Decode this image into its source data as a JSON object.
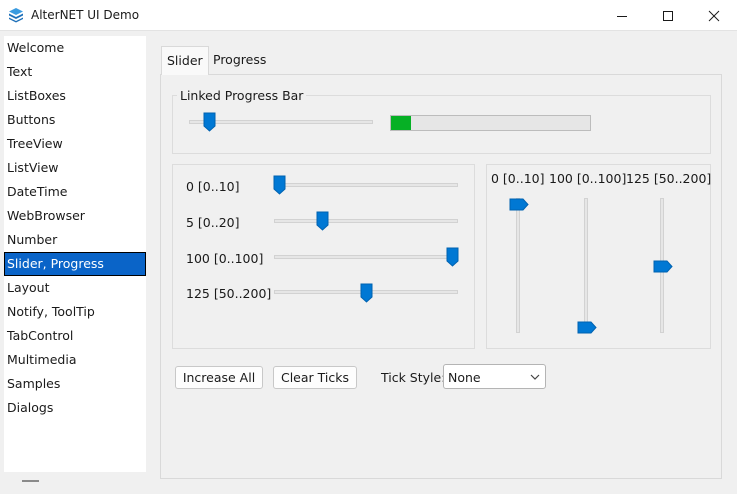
{
  "window": {
    "title": "AlterNET UI Demo"
  },
  "sidebar": {
    "items": [
      {
        "label": "Welcome"
      },
      {
        "label": "Text"
      },
      {
        "label": "ListBoxes"
      },
      {
        "label": "Buttons"
      },
      {
        "label": "TreeView"
      },
      {
        "label": "ListView"
      },
      {
        "label": "DateTime"
      },
      {
        "label": "WebBrowser"
      },
      {
        "label": "Number"
      },
      {
        "label": "Slider, Progress"
      },
      {
        "label": "Layout"
      },
      {
        "label": "Notify, ToolTip"
      },
      {
        "label": "TabControl"
      },
      {
        "label": "Multimedia"
      },
      {
        "label": "Samples"
      },
      {
        "label": "Dialogs"
      }
    ],
    "selected_index": 9
  },
  "tabs": [
    {
      "label": "Slider",
      "active": true
    },
    {
      "label": "Progress",
      "active": false
    }
  ],
  "linked_group": {
    "title": "Linked Progress Bar",
    "slider_value": 0.12,
    "progress_value": 0.1,
    "progress_color": "#06b025"
  },
  "horizontal_sliders": [
    {
      "label": "0 [0..10]",
      "value": 0,
      "min": 0,
      "max": 10
    },
    {
      "label": "5 [0..20]",
      "value": 5,
      "min": 0,
      "max": 20
    },
    {
      "label": "100 [0..100]",
      "value": 100,
      "min": 0,
      "max": 100
    },
    {
      "label": "125 [50..200]",
      "value": 125,
      "min": 50,
      "max": 200
    }
  ],
  "vertical_sliders": [
    {
      "label": "0 [0..10]",
      "value": 0,
      "min": 0,
      "max": 10
    },
    {
      "label": "100 [0..100]",
      "value": 100,
      "min": 0,
      "max": 100
    },
    {
      "label": "125 [50..200]",
      "value": 125,
      "min": 50,
      "max": 200
    }
  ],
  "buttons": {
    "increase_all": "Increase All",
    "clear_ticks": "Clear Ticks"
  },
  "tick_style": {
    "label": "Tick Style:",
    "selected": "None"
  },
  "colors": {
    "accent": "#0a64c8",
    "thumb": "#0078d4",
    "progress_fill": "#06b025"
  }
}
